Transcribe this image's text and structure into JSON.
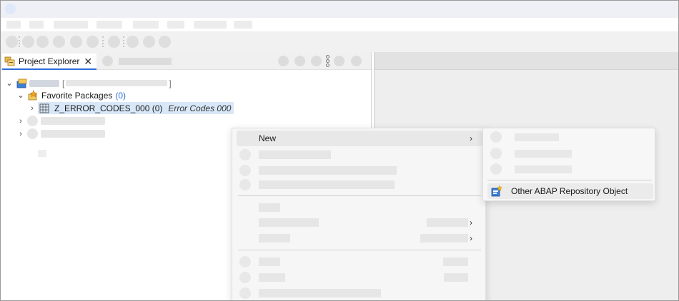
{
  "explorer": {
    "tab_label": "Project Explorer",
    "tab_close": "✕",
    "view_menu_icon": "vertical-dots-icon"
  },
  "tree": {
    "project_bracket_open": "[",
    "project_bracket_close": "]",
    "favorite_packages_label": "Favorite Packages",
    "favorite_packages_count": "(0)",
    "package_name": "Z_ERROR_CODES_000 (0)",
    "package_description": "Error Codes 000"
  },
  "context_menu": {
    "new_label": "New",
    "submenu_arrow": "›"
  },
  "submenu": {
    "other_object_label": "Other ABAP Repository Object"
  },
  "colors": {
    "accent_blue": "#2a6fd6",
    "selection": "#d8e8f8"
  }
}
